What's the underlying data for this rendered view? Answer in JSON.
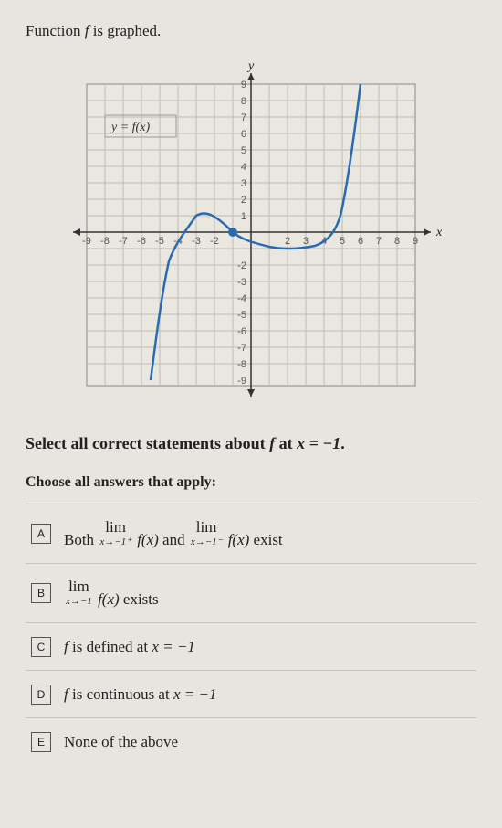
{
  "prompt": {
    "prefix": "Function ",
    "fvar": "f",
    "suffix": " is graphed."
  },
  "graph": {
    "y_label": "y",
    "x_label": "x",
    "curve_label_prefix": "y = ",
    "curve_label_fn": "f(x)",
    "x_ticks": [
      "-9",
      "-8",
      "-7",
      "-6",
      "-5",
      "-4",
      "-3",
      "-2",
      "2",
      "3",
      "4",
      "5",
      "6",
      "7",
      "8",
      "9"
    ],
    "y_ticks": [
      "9",
      "8",
      "7",
      "6",
      "5",
      "4",
      "3",
      "2",
      "1",
      "-2",
      "-3",
      "-4",
      "-5",
      "-6",
      "-7",
      "-8",
      "-9"
    ]
  },
  "chart_data": {
    "type": "line",
    "title": "",
    "xlabel": "x",
    "ylabel": "y",
    "xlim": [
      -9,
      9
    ],
    "ylim": [
      -9,
      9
    ],
    "series": [
      {
        "name": "f(x)",
        "x": [
          -5.5,
          -5,
          -4.5,
          -4,
          -3.5,
          -3,
          -2,
          -1,
          0,
          1,
          2,
          3,
          4,
          5,
          5.5,
          6
        ],
        "y": [
          -9,
          -4.5,
          -1.8,
          -0.2,
          0.7,
          1,
          0.8,
          0,
          -0.6,
          -0.9,
          -1,
          -0.9,
          -0.5,
          1.5,
          4,
          9
        ]
      }
    ],
    "points": [
      {
        "x": -1,
        "y": 0,
        "style": "filled"
      }
    ],
    "annotations": [
      {
        "text": "y = f(x)",
        "x": -7,
        "y": 6.5
      }
    ]
  },
  "question": {
    "prefix": "Select all correct statements about ",
    "fvar": "f",
    "mid": " at ",
    "eq": "x = −1",
    "suffix": "."
  },
  "sub_instruction": "Choose all answers that apply:",
  "choices": {
    "A": {
      "letter": "A",
      "parts": {
        "both": "Both ",
        "lim": "lim",
        "sub1": "x→−1⁺",
        "fx": "f(x)",
        "and": " and ",
        "sub2": "x→−1⁻",
        "exist": " exist"
      }
    },
    "B": {
      "letter": "B",
      "parts": {
        "lim": "lim",
        "sub": "x→−1",
        "fx": "f(x)",
        "exist": " exists"
      }
    },
    "C": {
      "letter": "C",
      "text_prefix": "f",
      "text_mid": " is defined at ",
      "text_eq": "x = −1"
    },
    "D": {
      "letter": "D",
      "text_prefix": "f",
      "text_mid": " is continuous at ",
      "text_eq": "x = −1"
    },
    "E": {
      "letter": "E",
      "text": "None of the above"
    }
  }
}
